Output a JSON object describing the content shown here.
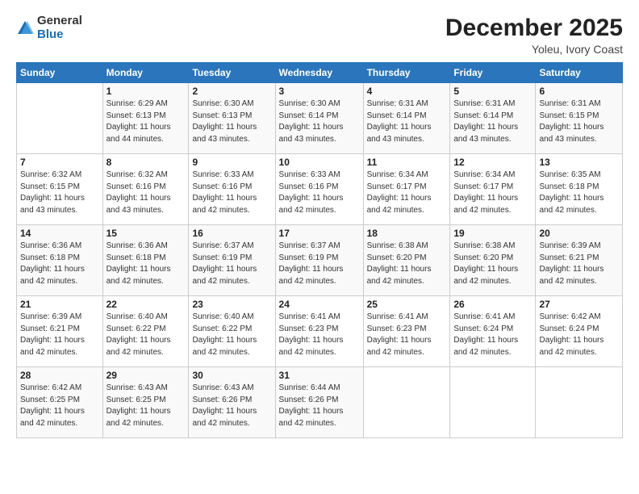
{
  "logo": {
    "general": "General",
    "blue": "Blue"
  },
  "title": "December 2025",
  "subtitle": "Yoleu, Ivory Coast",
  "days_header": [
    "Sunday",
    "Monday",
    "Tuesday",
    "Wednesday",
    "Thursday",
    "Friday",
    "Saturday"
  ],
  "weeks": [
    [
      {
        "day": "",
        "info": ""
      },
      {
        "day": "1",
        "info": "Sunrise: 6:29 AM\nSunset: 6:13 PM\nDaylight: 11 hours\nand 44 minutes."
      },
      {
        "day": "2",
        "info": "Sunrise: 6:30 AM\nSunset: 6:13 PM\nDaylight: 11 hours\nand 43 minutes."
      },
      {
        "day": "3",
        "info": "Sunrise: 6:30 AM\nSunset: 6:14 PM\nDaylight: 11 hours\nand 43 minutes."
      },
      {
        "day": "4",
        "info": "Sunrise: 6:31 AM\nSunset: 6:14 PM\nDaylight: 11 hours\nand 43 minutes."
      },
      {
        "day": "5",
        "info": "Sunrise: 6:31 AM\nSunset: 6:14 PM\nDaylight: 11 hours\nand 43 minutes."
      },
      {
        "day": "6",
        "info": "Sunrise: 6:31 AM\nSunset: 6:15 PM\nDaylight: 11 hours\nand 43 minutes."
      }
    ],
    [
      {
        "day": "7",
        "info": "Sunrise: 6:32 AM\nSunset: 6:15 PM\nDaylight: 11 hours\nand 43 minutes."
      },
      {
        "day": "8",
        "info": "Sunrise: 6:32 AM\nSunset: 6:16 PM\nDaylight: 11 hours\nand 43 minutes."
      },
      {
        "day": "9",
        "info": "Sunrise: 6:33 AM\nSunset: 6:16 PM\nDaylight: 11 hours\nand 42 minutes."
      },
      {
        "day": "10",
        "info": "Sunrise: 6:33 AM\nSunset: 6:16 PM\nDaylight: 11 hours\nand 42 minutes."
      },
      {
        "day": "11",
        "info": "Sunrise: 6:34 AM\nSunset: 6:17 PM\nDaylight: 11 hours\nand 42 minutes."
      },
      {
        "day": "12",
        "info": "Sunrise: 6:34 AM\nSunset: 6:17 PM\nDaylight: 11 hours\nand 42 minutes."
      },
      {
        "day": "13",
        "info": "Sunrise: 6:35 AM\nSunset: 6:18 PM\nDaylight: 11 hours\nand 42 minutes."
      }
    ],
    [
      {
        "day": "14",
        "info": "Sunrise: 6:36 AM\nSunset: 6:18 PM\nDaylight: 11 hours\nand 42 minutes."
      },
      {
        "day": "15",
        "info": "Sunrise: 6:36 AM\nSunset: 6:18 PM\nDaylight: 11 hours\nand 42 minutes."
      },
      {
        "day": "16",
        "info": "Sunrise: 6:37 AM\nSunset: 6:19 PM\nDaylight: 11 hours\nand 42 minutes."
      },
      {
        "day": "17",
        "info": "Sunrise: 6:37 AM\nSunset: 6:19 PM\nDaylight: 11 hours\nand 42 minutes."
      },
      {
        "day": "18",
        "info": "Sunrise: 6:38 AM\nSunset: 6:20 PM\nDaylight: 11 hours\nand 42 minutes."
      },
      {
        "day": "19",
        "info": "Sunrise: 6:38 AM\nSunset: 6:20 PM\nDaylight: 11 hours\nand 42 minutes."
      },
      {
        "day": "20",
        "info": "Sunrise: 6:39 AM\nSunset: 6:21 PM\nDaylight: 11 hours\nand 42 minutes."
      }
    ],
    [
      {
        "day": "21",
        "info": "Sunrise: 6:39 AM\nSunset: 6:21 PM\nDaylight: 11 hours\nand 42 minutes."
      },
      {
        "day": "22",
        "info": "Sunrise: 6:40 AM\nSunset: 6:22 PM\nDaylight: 11 hours\nand 42 minutes."
      },
      {
        "day": "23",
        "info": "Sunrise: 6:40 AM\nSunset: 6:22 PM\nDaylight: 11 hours\nand 42 minutes."
      },
      {
        "day": "24",
        "info": "Sunrise: 6:41 AM\nSunset: 6:23 PM\nDaylight: 11 hours\nand 42 minutes."
      },
      {
        "day": "25",
        "info": "Sunrise: 6:41 AM\nSunset: 6:23 PM\nDaylight: 11 hours\nand 42 minutes."
      },
      {
        "day": "26",
        "info": "Sunrise: 6:41 AM\nSunset: 6:24 PM\nDaylight: 11 hours\nand 42 minutes."
      },
      {
        "day": "27",
        "info": "Sunrise: 6:42 AM\nSunset: 6:24 PM\nDaylight: 11 hours\nand 42 minutes."
      }
    ],
    [
      {
        "day": "28",
        "info": "Sunrise: 6:42 AM\nSunset: 6:25 PM\nDaylight: 11 hours\nand 42 minutes."
      },
      {
        "day": "29",
        "info": "Sunrise: 6:43 AM\nSunset: 6:25 PM\nDaylight: 11 hours\nand 42 minutes."
      },
      {
        "day": "30",
        "info": "Sunrise: 6:43 AM\nSunset: 6:26 PM\nDaylight: 11 hours\nand 42 minutes."
      },
      {
        "day": "31",
        "info": "Sunrise: 6:44 AM\nSunset: 6:26 PM\nDaylight: 11 hours\nand 42 minutes."
      },
      {
        "day": "",
        "info": ""
      },
      {
        "day": "",
        "info": ""
      },
      {
        "day": "",
        "info": ""
      }
    ]
  ]
}
